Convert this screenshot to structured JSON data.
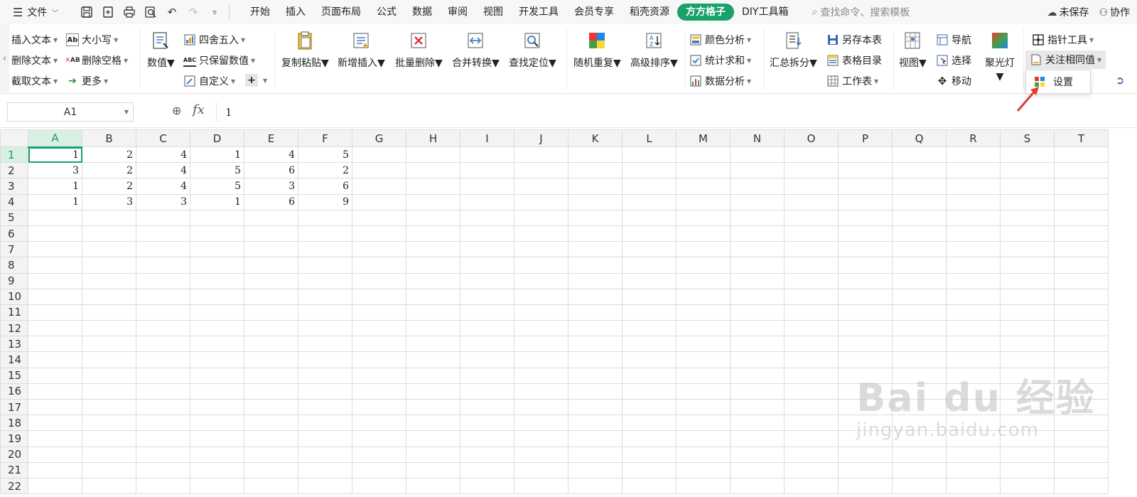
{
  "menubar": {
    "file_label": "文件",
    "tabs": [
      "开始",
      "插入",
      "页面布局",
      "公式",
      "数据",
      "审阅",
      "视图",
      "开发工具",
      "会员专享",
      "稻壳资源",
      "方方格子",
      "DIY工具箱"
    ],
    "active_tab": "方方格子",
    "search_placeholder": "查找命令、搜索模板",
    "unsaved_label": "未保存",
    "collab_label": "协作"
  },
  "ribbon": {
    "insert_text": "插入文本",
    "delete_text": "删除文本",
    "cut_text": "截取文本",
    "case": "大小写",
    "delete_space": "删除空格",
    "more": "更多",
    "numeric": "数值",
    "round": "四舍五入",
    "keep_numeric": "只保留数值",
    "custom": "自定义",
    "copy_paste": "复制粘贴",
    "new_insert": "新增插入",
    "batch_delete": "批量删除",
    "merge_convert": "合并转换",
    "find_locate": "查找定位",
    "random_repeat": "随机重复",
    "advanced_sort": "高级排序",
    "color_analysis": "颜色分析",
    "stat_sum": "统计求和",
    "data_analysis": "数据分析",
    "summary_split": "汇总拆分",
    "save_as_sheet": "另存本表",
    "sheet_toc": "表格目录",
    "worksheet": "工作表",
    "view": "视图",
    "navigate": "导航",
    "select": "选择",
    "move": "移动",
    "spotlight": "聚光灯",
    "pointer_tool": "指针工具",
    "watch_same": "关注相同值"
  },
  "popup": {
    "settings": "设置"
  },
  "formula_bar": {
    "cell_ref": "A1",
    "value": "1"
  },
  "sheet": {
    "columns": [
      "A",
      "B",
      "C",
      "D",
      "E",
      "F",
      "G",
      "H",
      "I",
      "J",
      "K",
      "L",
      "M",
      "N",
      "O",
      "P",
      "Q",
      "R",
      "S",
      "T"
    ],
    "rows": [
      [
        "1",
        "2",
        "4",
        "1",
        "4",
        "5"
      ],
      [
        "3",
        "2",
        "4",
        "5",
        "6",
        "2"
      ],
      [
        "1",
        "2",
        "4",
        "5",
        "3",
        "6"
      ],
      [
        "1",
        "3",
        "3",
        "1",
        "6",
        "9"
      ]
    ],
    "row_count": 22
  },
  "watermark": {
    "brand": "Bai du 经验",
    "url": "jingyan.baidu.com"
  },
  "colors": {
    "accent": "#1aa069",
    "arrow": "#e53935"
  }
}
